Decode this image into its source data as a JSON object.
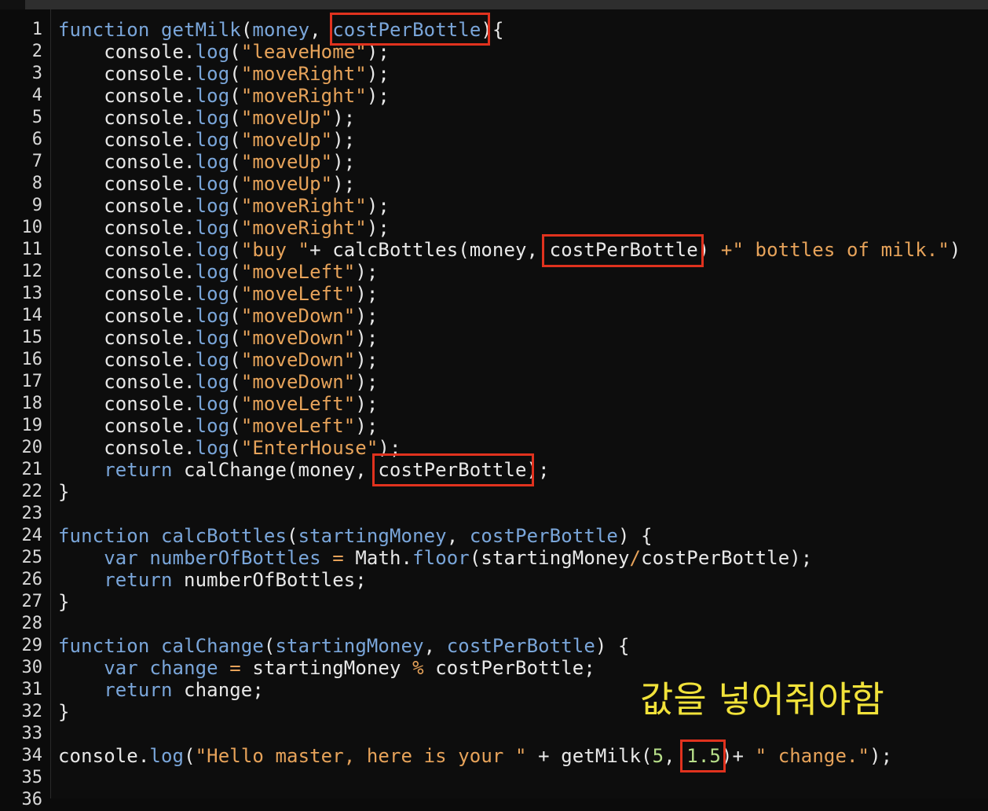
{
  "editor": {
    "lines": [
      [
        {
          "t": "function",
          "c": "kw"
        },
        {
          "t": " ",
          "c": "plain"
        },
        {
          "t": "getMilk",
          "c": "fn"
        },
        {
          "t": "(",
          "c": "plain"
        },
        {
          "t": "money",
          "c": "param"
        },
        {
          "t": ", ",
          "c": "plain"
        },
        {
          "t": "costPerBottle",
          "c": "param"
        },
        {
          "t": "){",
          "c": "plain"
        }
      ],
      [
        {
          "t": "    console.",
          "c": "plain"
        },
        {
          "t": "log",
          "c": "fn"
        },
        {
          "t": "(",
          "c": "plain"
        },
        {
          "t": "\"leaveHome\"",
          "c": "str"
        },
        {
          "t": ");",
          "c": "plain"
        }
      ],
      [
        {
          "t": "    console.",
          "c": "plain"
        },
        {
          "t": "log",
          "c": "fn"
        },
        {
          "t": "(",
          "c": "plain"
        },
        {
          "t": "\"moveRight\"",
          "c": "str"
        },
        {
          "t": ");",
          "c": "plain"
        }
      ],
      [
        {
          "t": "    console.",
          "c": "plain"
        },
        {
          "t": "log",
          "c": "fn"
        },
        {
          "t": "(",
          "c": "plain"
        },
        {
          "t": "\"moveRight\"",
          "c": "str"
        },
        {
          "t": ");",
          "c": "plain"
        }
      ],
      [
        {
          "t": "    console.",
          "c": "plain"
        },
        {
          "t": "log",
          "c": "fn"
        },
        {
          "t": "(",
          "c": "plain"
        },
        {
          "t": "\"moveUp\"",
          "c": "str"
        },
        {
          "t": ");",
          "c": "plain"
        }
      ],
      [
        {
          "t": "    console.",
          "c": "plain"
        },
        {
          "t": "log",
          "c": "fn"
        },
        {
          "t": "(",
          "c": "plain"
        },
        {
          "t": "\"moveUp\"",
          "c": "str"
        },
        {
          "t": ");",
          "c": "plain"
        }
      ],
      [
        {
          "t": "    console.",
          "c": "plain"
        },
        {
          "t": "log",
          "c": "fn"
        },
        {
          "t": "(",
          "c": "plain"
        },
        {
          "t": "\"moveUp\"",
          "c": "str"
        },
        {
          "t": ");",
          "c": "plain"
        }
      ],
      [
        {
          "t": "    console.",
          "c": "plain"
        },
        {
          "t": "log",
          "c": "fn"
        },
        {
          "t": "(",
          "c": "plain"
        },
        {
          "t": "\"moveUp\"",
          "c": "str"
        },
        {
          "t": ");",
          "c": "plain"
        }
      ],
      [
        {
          "t": "    console.",
          "c": "plain"
        },
        {
          "t": "log",
          "c": "fn"
        },
        {
          "t": "(",
          "c": "plain"
        },
        {
          "t": "\"moveRight\"",
          "c": "str"
        },
        {
          "t": ");",
          "c": "plain"
        }
      ],
      [
        {
          "t": "    console.",
          "c": "plain"
        },
        {
          "t": "log",
          "c": "fn"
        },
        {
          "t": "(",
          "c": "plain"
        },
        {
          "t": "\"moveRight\"",
          "c": "str"
        },
        {
          "t": ");",
          "c": "plain"
        }
      ],
      [
        {
          "t": "    console.",
          "c": "plain"
        },
        {
          "t": "log",
          "c": "fn"
        },
        {
          "t": "(",
          "c": "plain"
        },
        {
          "t": "\"buy \"",
          "c": "str"
        },
        {
          "t": "+ calcBottles(money, costPerBottle) ",
          "c": "plain"
        },
        {
          "t": "+",
          "c": "op"
        },
        {
          "t": "\" bottles of milk.\"",
          "c": "str"
        },
        {
          "t": ")",
          "c": "plain"
        }
      ],
      [
        {
          "t": "    console.",
          "c": "plain"
        },
        {
          "t": "log",
          "c": "fn"
        },
        {
          "t": "(",
          "c": "plain"
        },
        {
          "t": "\"moveLeft\"",
          "c": "str"
        },
        {
          "t": ");",
          "c": "plain"
        }
      ],
      [
        {
          "t": "    console.",
          "c": "plain"
        },
        {
          "t": "log",
          "c": "fn"
        },
        {
          "t": "(",
          "c": "plain"
        },
        {
          "t": "\"moveLeft\"",
          "c": "str"
        },
        {
          "t": ");",
          "c": "plain"
        }
      ],
      [
        {
          "t": "    console.",
          "c": "plain"
        },
        {
          "t": "log",
          "c": "fn"
        },
        {
          "t": "(",
          "c": "plain"
        },
        {
          "t": "\"moveDown\"",
          "c": "str"
        },
        {
          "t": ");",
          "c": "plain"
        }
      ],
      [
        {
          "t": "    console.",
          "c": "plain"
        },
        {
          "t": "log",
          "c": "fn"
        },
        {
          "t": "(",
          "c": "plain"
        },
        {
          "t": "\"moveDown\"",
          "c": "str"
        },
        {
          "t": ");",
          "c": "plain"
        }
      ],
      [
        {
          "t": "    console.",
          "c": "plain"
        },
        {
          "t": "log",
          "c": "fn"
        },
        {
          "t": "(",
          "c": "plain"
        },
        {
          "t": "\"moveDown\"",
          "c": "str"
        },
        {
          "t": ");",
          "c": "plain"
        }
      ],
      [
        {
          "t": "    console.",
          "c": "plain"
        },
        {
          "t": "log",
          "c": "fn"
        },
        {
          "t": "(",
          "c": "plain"
        },
        {
          "t": "\"moveDown\"",
          "c": "str"
        },
        {
          "t": ");",
          "c": "plain"
        }
      ],
      [
        {
          "t": "    console.",
          "c": "plain"
        },
        {
          "t": "log",
          "c": "fn"
        },
        {
          "t": "(",
          "c": "plain"
        },
        {
          "t": "\"moveLeft\"",
          "c": "str"
        },
        {
          "t": ");",
          "c": "plain"
        }
      ],
      [
        {
          "t": "    console.",
          "c": "plain"
        },
        {
          "t": "log",
          "c": "fn"
        },
        {
          "t": "(",
          "c": "plain"
        },
        {
          "t": "\"moveLeft\"",
          "c": "str"
        },
        {
          "t": ");",
          "c": "plain"
        }
      ],
      [
        {
          "t": "    console.",
          "c": "plain"
        },
        {
          "t": "log",
          "c": "fn"
        },
        {
          "t": "(",
          "c": "plain"
        },
        {
          "t": "\"EnterHouse\"",
          "c": "str"
        },
        {
          "t": ");",
          "c": "plain"
        }
      ],
      [
        {
          "t": "    ",
          "c": "plain"
        },
        {
          "t": "return",
          "c": "kw"
        },
        {
          "t": " calChange(money, costPerBottle);",
          "c": "plain"
        }
      ],
      [
        {
          "t": "}",
          "c": "plain"
        }
      ],
      [],
      [
        {
          "t": "function",
          "c": "kw"
        },
        {
          "t": " ",
          "c": "plain"
        },
        {
          "t": "calcBottles",
          "c": "fn"
        },
        {
          "t": "(",
          "c": "plain"
        },
        {
          "t": "startingMoney",
          "c": "param"
        },
        {
          "t": ", ",
          "c": "plain"
        },
        {
          "t": "costPerBottle",
          "c": "param"
        },
        {
          "t": ") {",
          "c": "plain"
        }
      ],
      [
        {
          "t": "    ",
          "c": "plain"
        },
        {
          "t": "var",
          "c": "kw"
        },
        {
          "t": " ",
          "c": "plain"
        },
        {
          "t": "numberOfBottles",
          "c": "param"
        },
        {
          "t": " ",
          "c": "plain"
        },
        {
          "t": "=",
          "c": "op"
        },
        {
          "t": " Math.",
          "c": "plain"
        },
        {
          "t": "floor",
          "c": "fn"
        },
        {
          "t": "(startingMoney",
          "c": "plain"
        },
        {
          "t": "/",
          "c": "op"
        },
        {
          "t": "costPerBottle);",
          "c": "plain"
        }
      ],
      [
        {
          "t": "    ",
          "c": "plain"
        },
        {
          "t": "return",
          "c": "kw"
        },
        {
          "t": " numberOfBottles;",
          "c": "plain"
        }
      ],
      [
        {
          "t": "}",
          "c": "plain"
        }
      ],
      [],
      [
        {
          "t": "function",
          "c": "kw"
        },
        {
          "t": " ",
          "c": "plain"
        },
        {
          "t": "calChange",
          "c": "fn"
        },
        {
          "t": "(",
          "c": "plain"
        },
        {
          "t": "startingMoney",
          "c": "param"
        },
        {
          "t": ", ",
          "c": "plain"
        },
        {
          "t": "costPerBottle",
          "c": "param"
        },
        {
          "t": ") {",
          "c": "plain"
        }
      ],
      [
        {
          "t": "    ",
          "c": "plain"
        },
        {
          "t": "var",
          "c": "kw"
        },
        {
          "t": " ",
          "c": "plain"
        },
        {
          "t": "change",
          "c": "param"
        },
        {
          "t": " ",
          "c": "plain"
        },
        {
          "t": "=",
          "c": "op"
        },
        {
          "t": " startingMoney ",
          "c": "plain"
        },
        {
          "t": "%",
          "c": "op"
        },
        {
          "t": " costPerBottle;",
          "c": "plain"
        }
      ],
      [
        {
          "t": "    ",
          "c": "plain"
        },
        {
          "t": "return",
          "c": "kw"
        },
        {
          "t": " change;",
          "c": "plain"
        }
      ],
      [
        {
          "t": "}",
          "c": "plain"
        }
      ],
      [],
      [
        {
          "t": "console.",
          "c": "plain"
        },
        {
          "t": "log",
          "c": "fn"
        },
        {
          "t": "(",
          "c": "plain"
        },
        {
          "t": "\"Hello master, here is your \"",
          "c": "str"
        },
        {
          "t": " + getMilk(",
          "c": "plain"
        },
        {
          "t": "5",
          "c": "num"
        },
        {
          "t": ", ",
          "c": "plain"
        },
        {
          "t": "1.5",
          "c": "num"
        },
        {
          "t": ")+ ",
          "c": "plain"
        },
        {
          "t": "\" change.\"",
          "c": "str"
        },
        {
          "t": ");",
          "c": "plain"
        }
      ],
      [],
      []
    ]
  },
  "annotation": {
    "text": "값을 넣어줘야함"
  },
  "colors": {
    "highlight_box": "#e0321e",
    "annotation_text": "#f1e23a",
    "keyword": "#7aa6da",
    "string": "#e7a35a",
    "number": "#b8e08a"
  }
}
